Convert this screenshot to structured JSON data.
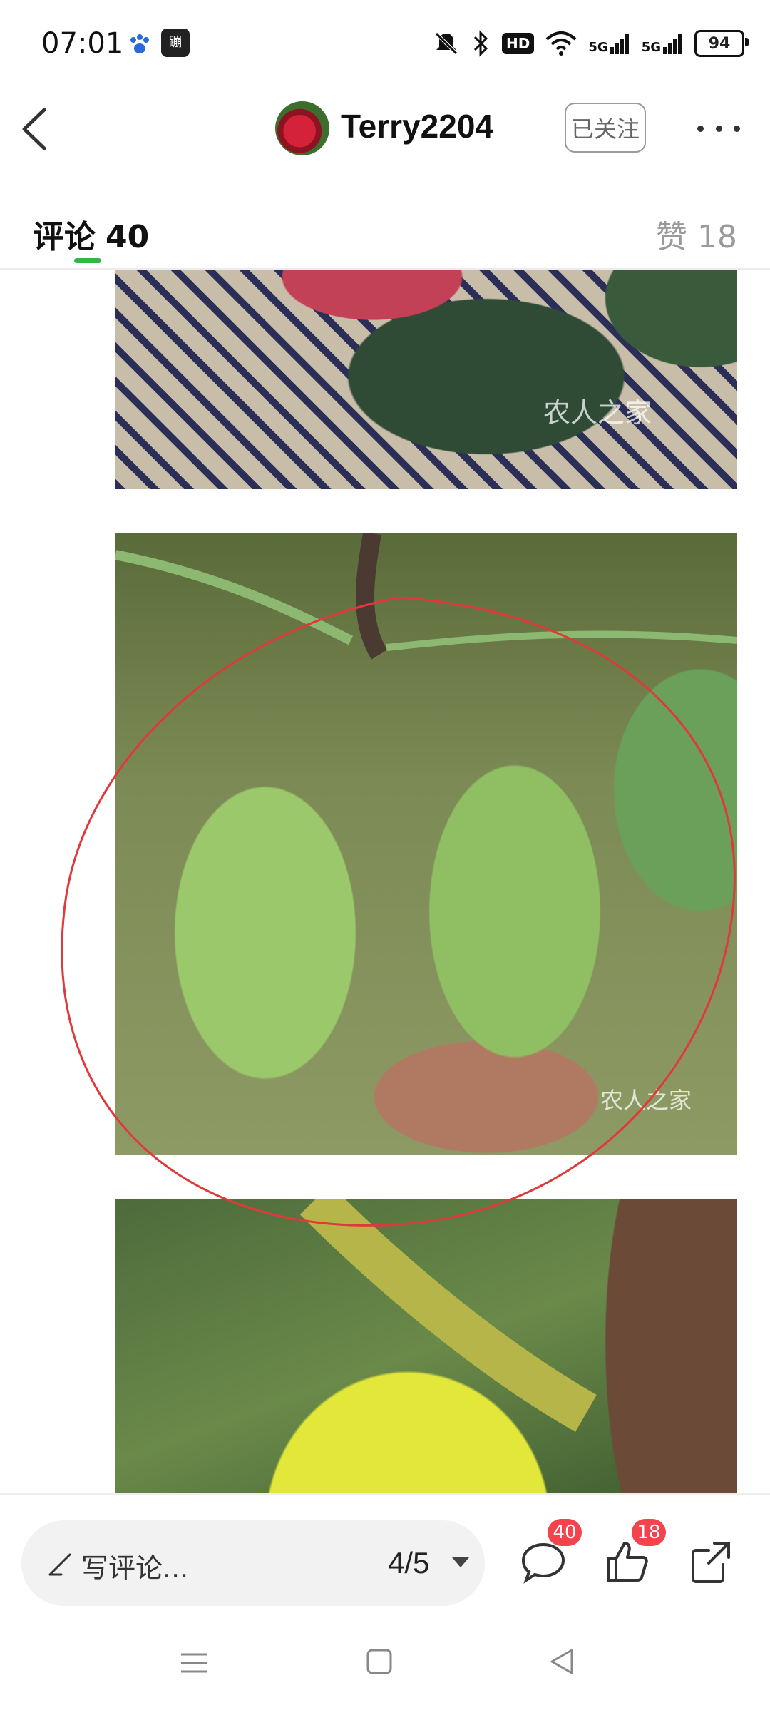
{
  "status_bar": {
    "time": "07:01",
    "app_icons": [
      "paw-icon",
      "app-icon"
    ],
    "app2_label": "蹦",
    "hd_label": "HD",
    "signal1": "5G",
    "signal2": "5G",
    "battery": "94"
  },
  "header": {
    "username": "Terry2204",
    "follow_label": "已关注"
  },
  "tabs": {
    "comments_label": "评论",
    "comments_count": "40",
    "likes_label": "赞",
    "likes_count": "18"
  },
  "images": {
    "watermark": "农人之家"
  },
  "bottom_bar": {
    "comment_placeholder": "写评论...",
    "page_indicator": "4/5",
    "comment_badge": "40",
    "like_badge": "18"
  },
  "colors": {
    "accent_green": "#2fb84a",
    "badge_red": "#f3434c",
    "annotation_red": "#e0393b"
  }
}
